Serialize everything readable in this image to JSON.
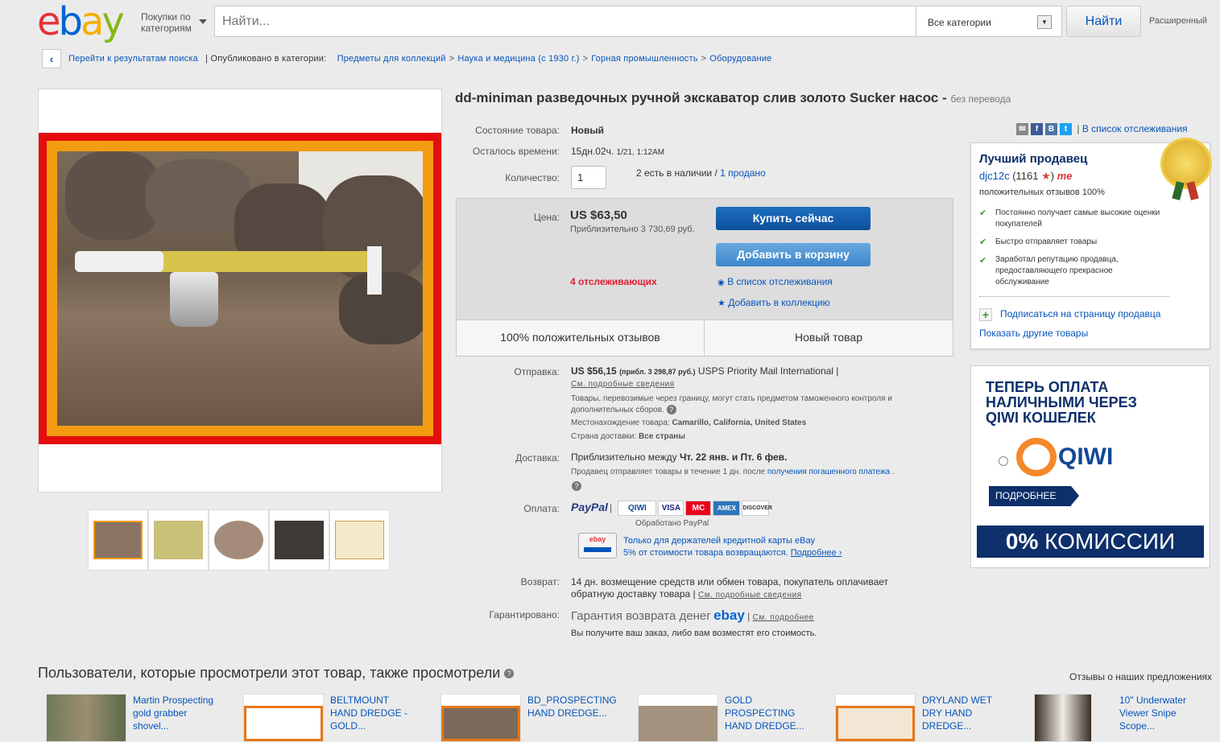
{
  "header": {
    "logo_letters": [
      "e",
      "b",
      "a",
      "y"
    ],
    "shop_by": "Покупки по категориям",
    "search_placeholder": "Найти...",
    "category_select": "Все категории",
    "find_button": "Найти",
    "advanced": "Расширенный"
  },
  "breadcrumb": {
    "back": "Перейти к результатам поиска",
    "published_in": "| Опубликовано в категории:",
    "items": [
      "Предметы для коллекций",
      "Наука и медицина (с 1930 г.)",
      "Горная промышленность",
      "Оборудование"
    ],
    "separator": ">"
  },
  "item": {
    "title": "dd-miniman разведочных ручной экскаватор слив золото Sucker насос -",
    "title_note": "без перевода",
    "condition_label": "Состояние товара:",
    "condition": "Новый",
    "time_left_label": "Осталось времени:",
    "time_left": "15дн.02ч.",
    "time_left_date": "1/21, 1:12AM",
    "quantity_label": "Количество:",
    "quantity": "1",
    "available": "2 есть в наличии /",
    "sold": "1 продано",
    "price_label": "Цена:",
    "price": "US $63,50",
    "price_approx": "Приблизительно 3 730,69 руб.",
    "buy_now": "Купить сейчас",
    "add_to_cart": "Добавить в корзину",
    "watchers": "4 отслеживающих",
    "add_watch": "В список отслеживания",
    "add_collection": "Добавить в коллекцию",
    "positive": "100% положительных отзывов",
    "new_item": "Новый товар"
  },
  "shipping": {
    "label": "Отправка:",
    "cost": "US $56,15",
    "cost_approx": "(прибл. 3 298,87 руб.)",
    "service": "USPS Priority Mail International |",
    "details_link": "См. подробные сведения",
    "customs_note": "Товары, перевозимые через границу, могут стать предметом таможенного контроля и дополнительных сборов.",
    "location_label": "Местонахождение товара:",
    "location": "Camarillo, California, United States",
    "ship_to_label": "Страна доставки:",
    "ship_to": "Все страны"
  },
  "delivery": {
    "label": "Доставка:",
    "estimate_prefix": "Приблизительно между",
    "estimate": "Чт. 22 янв. и Пт. 6 фев.",
    "handling": "Продавец отправляет товары в течение 1 дн. после",
    "handling_link": "получения погашенного платежа",
    "handling_end": "."
  },
  "payment": {
    "label": "Оплата:",
    "methods": [
      "PayPal",
      "QIWI",
      "VISA",
      "MC",
      "AMEX",
      "DISCOVER"
    ],
    "processed": "Обработано PayPal",
    "card_offer_1": "Только для держателей кредитной карты eBay",
    "card_offer_2": "5% от стоимости товара возвращаются.",
    "card_more": "Подробнее ›"
  },
  "returns": {
    "label": "Возврат:",
    "text": "14 дн. возмещение средств или обмен товара, покупатель оплачивает обратную доставку товара |",
    "link": "См. подробные сведения"
  },
  "guarantee": {
    "label": "Гарантировано:",
    "text": "Гарантия возврата денег",
    "brand": "ebay",
    "link": "См. подробнее",
    "sub": "Вы получите ваш заказ, либо вам возместят его стоимость."
  },
  "share": {
    "watchlist": "В список отслеживания"
  },
  "seller": {
    "top_rated": "Лучший продавец",
    "name": "djc12c",
    "score": "(1161",
    "score_end": ")",
    "me": "me",
    "feedback": "положительных отзывов 100%",
    "bullets": [
      "Постоянно получает самые высокие оценки покупателей",
      "Быстро отправляет товары",
      "Заработал репутацию продавца, предоставляющего прекрасное обслуживание"
    ],
    "subscribe": "Подписаться на страницу продавца",
    "other_items": "Показать другие товары"
  },
  "qiwi_ad": {
    "headline": "ТЕПЕРЬ ОПЛАТА НАЛИЧНЫМИ ЧЕРЕЗ QIWI КОШЕЛЕК",
    "logo": "QIWI",
    "more": "ПОДРОБНЕЕ",
    "commission_num": "0%",
    "commission": "КОМИССИИ"
  },
  "also_viewed": {
    "heading": "Пользователи, которые просмотрели этот товар, также просмотрели",
    "feedback": "Отзывы о наших предложениях",
    "items": [
      "Martin Prospecting gold grabber shovel...",
      "BELTMOUNT HAND DREDGE - GOLD...",
      "BD_PROSPECTING HAND DREDGE...",
      "GOLD PROSPECTING HAND DREDGE...",
      "DRYLAND WET DRY HAND DREDGE...",
      "10\" Underwater Viewer Snipe Scope..."
    ]
  }
}
